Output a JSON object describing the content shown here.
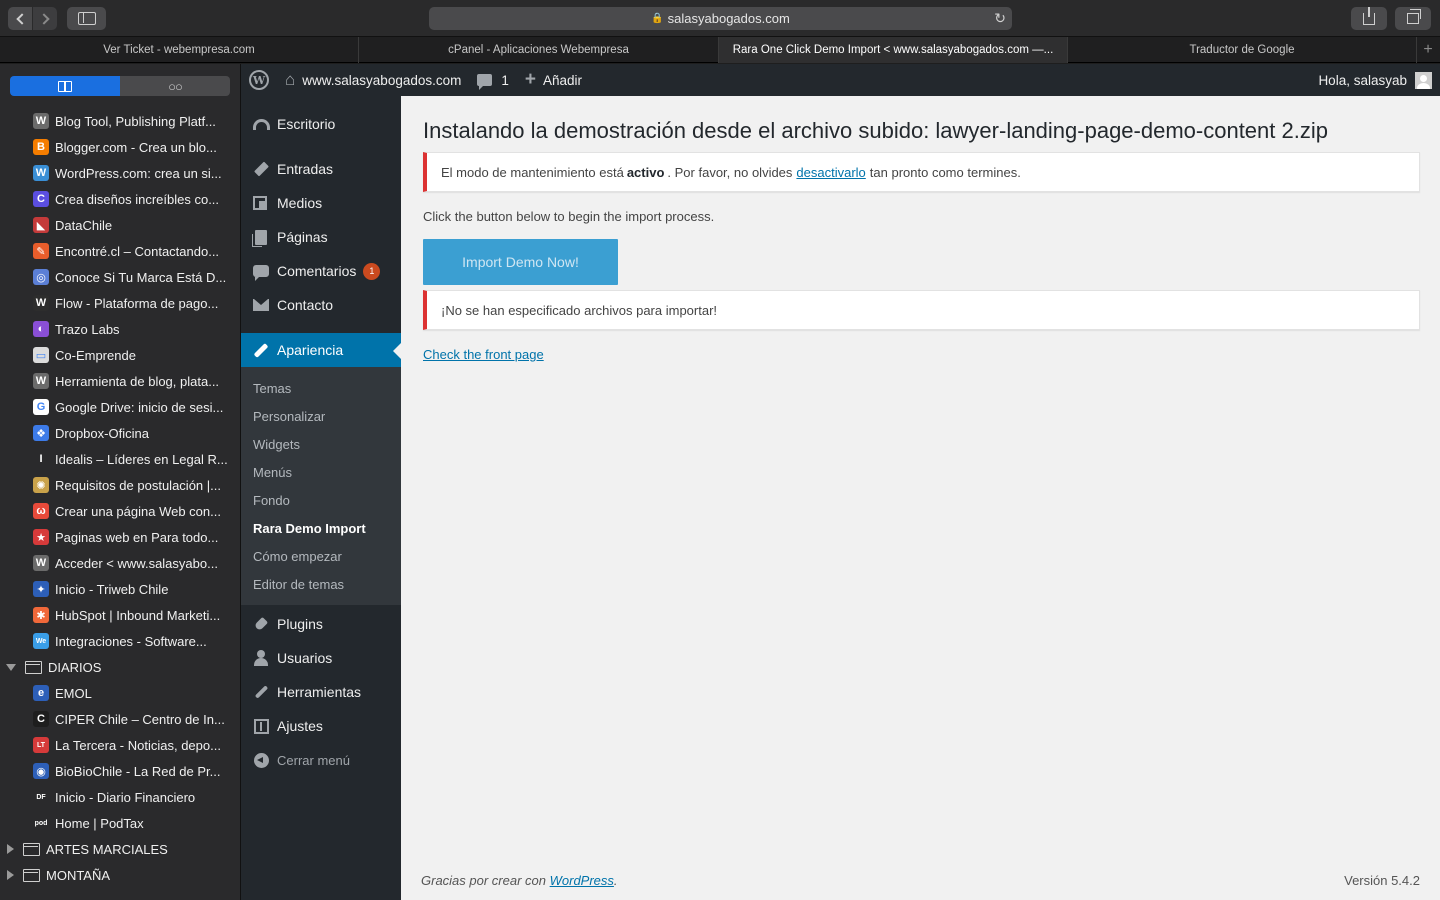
{
  "browser": {
    "url": "salasyabogados.com",
    "tabs": [
      {
        "label": "Ver Ticket - webempresa.com",
        "active": false
      },
      {
        "label": "cPanel - Aplicaciones Webempresa",
        "active": false
      },
      {
        "label": "Rara One Click Demo Import < www.salasyabogados.com —...",
        "active": true
      },
      {
        "label": "Traductor de Google",
        "active": false
      }
    ],
    "new_tab_label": "+"
  },
  "bookmarks": {
    "items": [
      {
        "label": "Blog Tool, Publishing Platf...",
        "icon": "wordpress-icon",
        "color": "#6b6b6b",
        "glyph": "W"
      },
      {
        "label": "Blogger.com - Crea un blo...",
        "icon": "blogger-icon",
        "color": "#f57d00",
        "glyph": "B"
      },
      {
        "label": "WordPress.com: crea un si...",
        "icon": "wordpress-icon",
        "color": "#3a8fd6",
        "glyph": "W"
      },
      {
        "label": "Crea diseños increíbles co...",
        "icon": "canva-icon",
        "color": "#5b4ee0",
        "glyph": "C"
      },
      {
        "label": "DataChile",
        "icon": "datachile-icon",
        "color": "#c43a3a",
        "glyph": "◣"
      },
      {
        "label": "Encontré.cl – Contactando...",
        "icon": "encontre-icon",
        "color": "#e85d2b",
        "glyph": "✎"
      },
      {
        "label": "Conoce Si Tu Marca Está D...",
        "icon": "marca-icon",
        "color": "#5b7fd6",
        "glyph": "◎"
      },
      {
        "label": "Flow - Plataforma de pago...",
        "icon": "flow-icon",
        "color": "#2d2d2d",
        "glyph": "W"
      },
      {
        "label": "Trazo Labs",
        "icon": "trazo-icon",
        "color": "#8a4fd6",
        "glyph": "◐"
      },
      {
        "label": "Co-Emprende",
        "icon": "coemprende-icon",
        "color": "#dcdcdc",
        "glyph": "▭"
      },
      {
        "label": "Herramienta de blog, plata...",
        "icon": "wordpress-icon",
        "color": "#6b6b6b",
        "glyph": "W"
      },
      {
        "label": "Google Drive: inicio de sesi...",
        "icon": "google-icon",
        "color": "#ffffff",
        "glyph": "G"
      },
      {
        "label": "Dropbox-Oficina",
        "icon": "dropbox-icon",
        "color": "#3d7be8",
        "glyph": "❖"
      },
      {
        "label": "Idealis – Líderes en Legal R...",
        "icon": "idealis-icon",
        "color": "#2a2a2c",
        "glyph": "I"
      },
      {
        "label": "Requisitos de postulación |...",
        "icon": "requisitos-icon",
        "color": "#c9a24a",
        "glyph": "✺"
      },
      {
        "label": "Crear una página Web con...",
        "icon": "wix-icon",
        "color": "#e84a3a",
        "glyph": "ω"
      },
      {
        "label": "Paginas web en Para todo...",
        "icon": "chile-flag-icon",
        "color": "#d63a3a",
        "glyph": "★"
      },
      {
        "label": "Acceder < www.salasyabo...",
        "icon": "wordpress-icon",
        "color": "#6b6b6b",
        "glyph": "W"
      },
      {
        "label": "Inicio - Triweb Chile",
        "icon": "triweb-icon",
        "color": "#2d5fb8",
        "glyph": "✦"
      },
      {
        "label": "HubSpot | Inbound Marketi...",
        "icon": "hubspot-icon",
        "color": "#f0683a",
        "glyph": "✱"
      },
      {
        "label": "Integraciones - Software...",
        "icon": "integraciones-icon",
        "color": "#3a9ee8",
        "glyph": "We"
      }
    ],
    "folder_diarios": "DIARIOS",
    "diarios": [
      {
        "label": "EMOL",
        "icon": "emol-icon",
        "color": "#2d5fb8",
        "glyph": "e"
      },
      {
        "label": "CIPER Chile – Centro de In...",
        "icon": "ciper-icon",
        "color": "#1e1e1e",
        "glyph": "C"
      },
      {
        "label": "La Tercera - Noticias, depo...",
        "icon": "latercera-icon",
        "color": "#d63a3a",
        "glyph": "LT"
      },
      {
        "label": "BioBioChile - La Red de Pr...",
        "icon": "biobio-icon",
        "color": "#2d5fb8",
        "glyph": "◉"
      },
      {
        "label": "Inicio - Diario Financiero",
        "icon": "df-icon",
        "color": "#2a2a2c",
        "glyph": "DF"
      },
      {
        "label": "Home | PodTax",
        "icon": "podtax-icon",
        "color": "#2a2a2c",
        "glyph": "pod"
      }
    ],
    "folder_artes": "ARTES MARCIALES",
    "folder_montana": "MONTAÑA"
  },
  "adminbar": {
    "site_name": "www.salasyabogados.com",
    "comments_count": "1",
    "add_label": "Añadir",
    "greeting": "Hola, salasyab"
  },
  "menu": {
    "escritorio": "Escritorio",
    "entradas": "Entradas",
    "medios": "Medios",
    "paginas": "Páginas",
    "comentarios": "Comentarios",
    "comentarios_badge": "1",
    "contacto": "Contacto",
    "apariencia": "Apariencia",
    "sub": [
      "Temas",
      "Personalizar",
      "Widgets",
      "Menús",
      "Fondo",
      "Rara Demo Import",
      "Cómo empezar",
      "Editor de temas"
    ],
    "plugins": "Plugins",
    "usuarios": "Usuarios",
    "herramientas": "Herramientas",
    "ajustes": "Ajustes",
    "cerrar": "Cerrar menú"
  },
  "content": {
    "title": "Instalando la demostración desde el archivo subido: lawyer-landing-page-demo-content 2.zip",
    "maint_before": "El modo de mantenimiento está",
    "maint_bold": "activo",
    "maint_mid": ". Por favor, no olvides",
    "maint_link": "desactivarlo",
    "maint_after": "tan pronto como termines.",
    "intro": "Click the button below to begin the import process.",
    "import_button": "Import Demo Now!",
    "error_notice": "¡No se han especificado archivos para importar!",
    "front_link": "Check the front page",
    "footer_text": "Gracias por crear con",
    "footer_link": "WordPress",
    "footer_period": ".",
    "version": "Versión 5.4.2"
  },
  "colors": {
    "wp_dark": "#23282d",
    "wp_blue": "#0073aa",
    "button_blue": "#3b9fd2",
    "error_red": "#dc3232",
    "badge_orange": "#ca4a1f"
  }
}
